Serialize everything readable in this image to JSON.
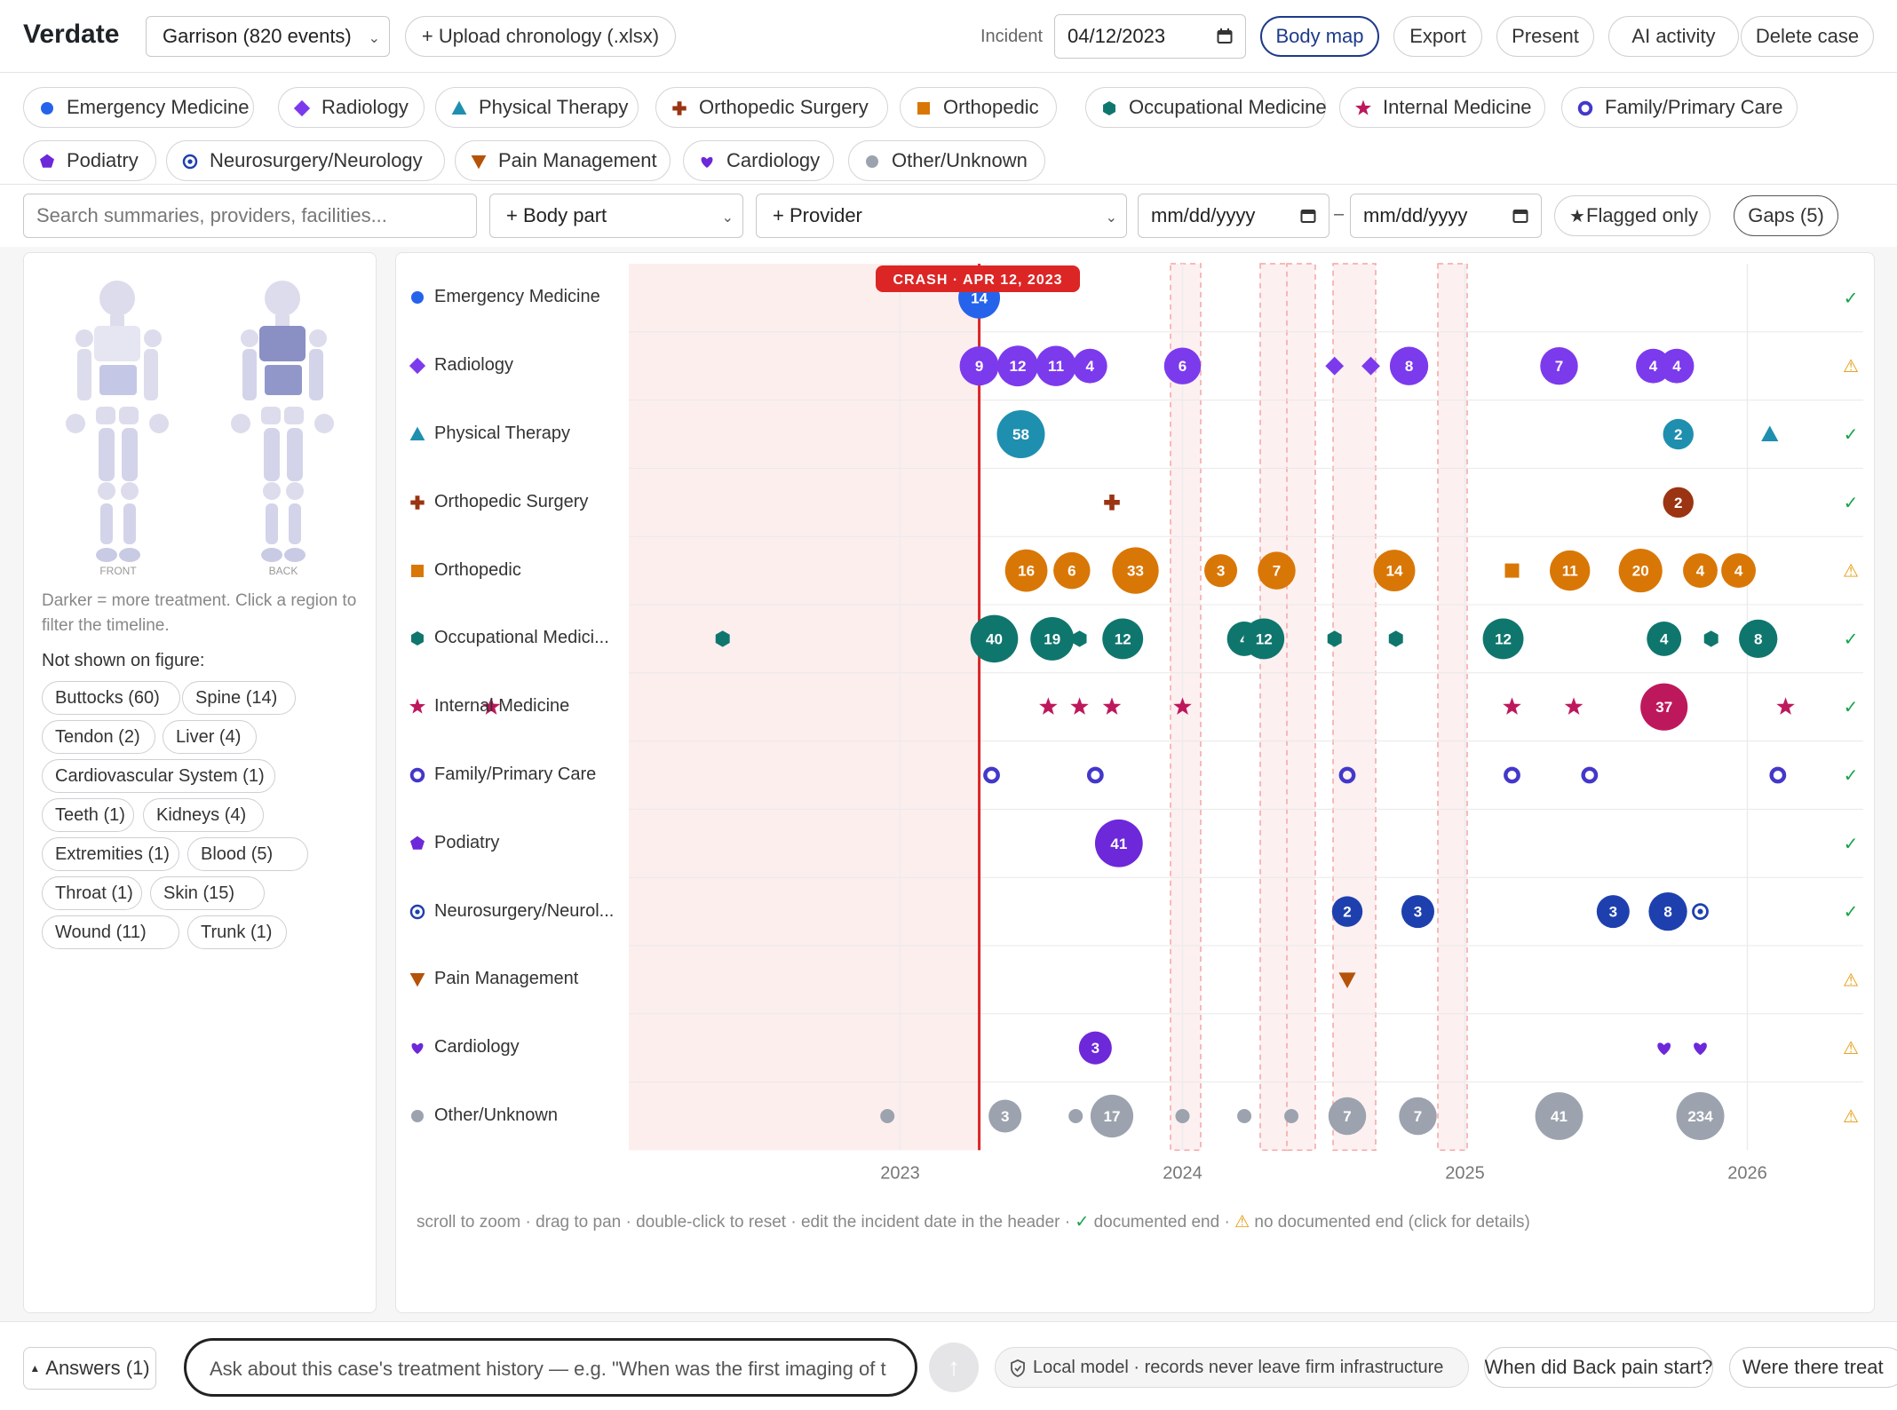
{
  "app": {
    "brand": "Verdate"
  },
  "header": {
    "case_select": "Garrison (820 events)",
    "upload_label": "+ Upload chronology (.xlsx)",
    "incident_label": "Incident",
    "incident_date": "04/12/2023",
    "buttons": {
      "body_map": "Body map",
      "export": "Export",
      "present": "Present",
      "ai_activity": "AI activity",
      "delete_case": "Delete case"
    }
  },
  "legend": [
    {
      "label": "Emergency Medicine",
      "icon": "circle-icon",
      "color": "#2563eb"
    },
    {
      "label": "Radiology",
      "icon": "diamond-icon",
      "color": "#7c3aed"
    },
    {
      "label": "Physical Therapy",
      "icon": "triangle-icon",
      "color": "#1f8fb0"
    },
    {
      "label": "Orthopedic Surgery",
      "icon": "cross-icon",
      "color": "#9a3412"
    },
    {
      "label": "Orthopedic",
      "icon": "square-icon",
      "color": "#d97706"
    },
    {
      "label": "Occupational Medicine",
      "icon": "hexagon-icon",
      "color": "#0f766e"
    },
    {
      "label": "Internal Medicine",
      "icon": "star-icon",
      "color": "#be185d"
    },
    {
      "label": "Family/Primary Care",
      "icon": "ring-icon",
      "color": "#4338ca"
    },
    {
      "label": "Podiatry",
      "icon": "pentagon-icon",
      "color": "#6d28d9"
    },
    {
      "label": "Neurosurgery/Neurology",
      "icon": "target-icon",
      "color": "#1e40af"
    },
    {
      "label": "Pain Management",
      "icon": "down-triangle-icon",
      "color": "#b45309"
    },
    {
      "label": "Cardiology",
      "icon": "heart-icon",
      "color": "#6d28d9"
    },
    {
      "label": "Other/Unknown",
      "icon": "circle-icon",
      "color": "#9ca3af"
    }
  ],
  "filters": {
    "search_placeholder": "Search summaries, providers, facilities...",
    "body_part": "+ Body part",
    "provider": "+ Provider",
    "date_from": "mm/dd/yyyy",
    "date_to": "mm/dd/yyyy",
    "date_sep": "–",
    "flagged": "Flagged only",
    "gaps": "Gaps (5)"
  },
  "body_map": {
    "front_label": "FRONT",
    "back_label": "BACK",
    "hint": "Darker = more treatment. Click a region to filter the timeline.",
    "not_shown_label": "Not shown on figure:",
    "tags": [
      "Buttocks (60)",
      "Spine (14)",
      "Tendon (2)",
      "Liver (4)",
      "Cardiovascular System (1)",
      "Teeth (1)",
      "Kidneys (4)",
      "Extremities (1)",
      "Blood (5)",
      "Throat (1)",
      "Skin (15)",
      "Wound (11)",
      "Trunk (1)"
    ]
  },
  "timeline": {
    "crash_label": "CRASH · APR 12, 2023",
    "year_ticks": [
      "2023",
      "2024",
      "2025",
      "2026"
    ],
    "rows": [
      "Emergency Medicine",
      "Radiology",
      "Physical Therapy",
      "Orthopedic Surgery",
      "Orthopedic",
      "Occupational Medici...",
      "Internal Medicine",
      "Family/Primary Care",
      "Podiatry",
      "Neurosurgery/Neurol...",
      "Pain Management",
      "Cardiology",
      "Other/Unknown"
    ],
    "row_status": [
      "check",
      "warn",
      "check",
      "check",
      "warn",
      "check",
      "check",
      "check",
      "check",
      "check",
      "warn",
      "warn",
      "warn"
    ],
    "footer": {
      "instructions": "scroll to zoom · drag to pan · double-click to reset · edit the incident date in the header ·",
      "documented_end": "documented end ·",
      "no_documented_end": "no documented end (click for details)"
    }
  },
  "bottom": {
    "answers": "Answers (1)",
    "ask_placeholder": "Ask about this case's treatment history — e.g. \"When was the first imaging of t",
    "privacy": "Local model · records never leave firm infrastructure",
    "suggestion_1": "When did Back pain start?",
    "suggestion_2": "Were there treat"
  }
}
